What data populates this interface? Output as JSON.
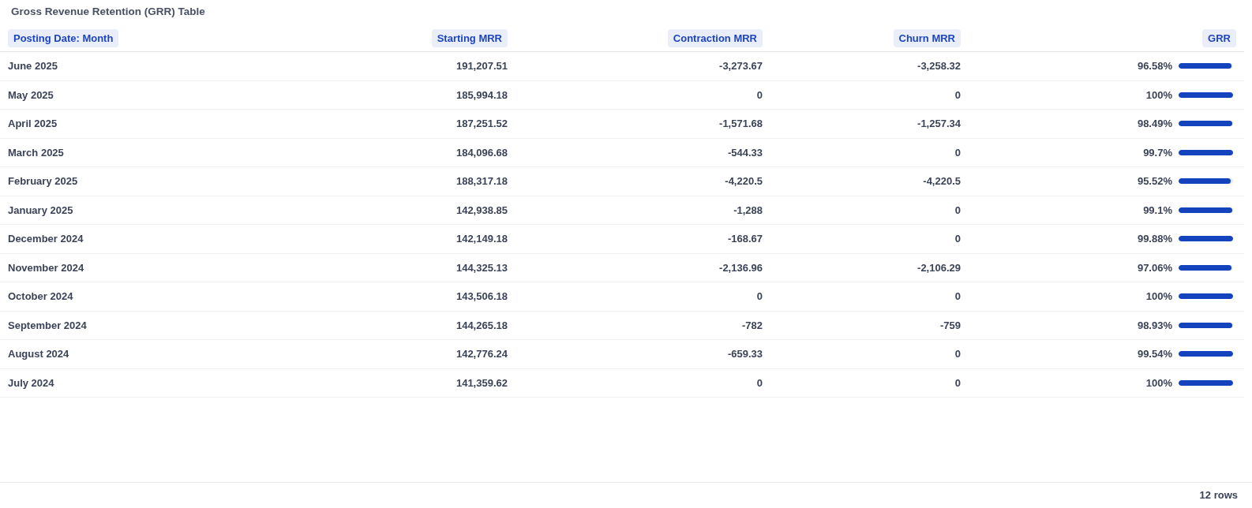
{
  "title": "Gross Revenue Retention (GRR) Table",
  "table": {
    "columns": [
      "Posting Date: Month",
      "Starting MRR",
      "Contraction MRR",
      "Churn MRR",
      "GRR"
    ],
    "rows": [
      {
        "month": "June 2025",
        "starting_mrr": "191,207.51",
        "contraction_mrr": "-3,273.67",
        "churn_mrr": "-3,258.32",
        "grr": "96.58%",
        "level": 0.9658
      },
      {
        "month": "May 2025",
        "starting_mrr": "185,994.18",
        "contraction_mrr": "0",
        "churn_mrr": "0",
        "grr": "100%",
        "level": 1
      },
      {
        "month": "April 2025",
        "starting_mrr": "187,251.52",
        "contraction_mrr": "-1,571.68",
        "churn_mrr": "-1,257.34",
        "grr": "98.49%",
        "level": 0.9849
      },
      {
        "month": "March 2025",
        "starting_mrr": "184,096.68",
        "contraction_mrr": "-544.33",
        "churn_mrr": "0",
        "grr": "99.7%",
        "level": 0.997
      },
      {
        "month": "February 2025",
        "starting_mrr": "188,317.18",
        "contraction_mrr": "-4,220.5",
        "churn_mrr": "-4,220.5",
        "grr": "95.52%",
        "level": 0.9552
      },
      {
        "month": "January 2025",
        "starting_mrr": "142,938.85",
        "contraction_mrr": "-1,288",
        "churn_mrr": "0",
        "grr": "99.1%",
        "level": 0.991
      },
      {
        "month": "December 2024",
        "starting_mrr": "142,149.18",
        "contraction_mrr": "-168.67",
        "churn_mrr": "0",
        "grr": "99.88%",
        "level": 0.9988
      },
      {
        "month": "November 2024",
        "starting_mrr": "144,325.13",
        "contraction_mrr": "-2,136.96",
        "churn_mrr": "-2,106.29",
        "grr": "97.06%",
        "level": 0.9706
      },
      {
        "month": "October 2024",
        "starting_mrr": "143,506.18",
        "contraction_mrr": "0",
        "churn_mrr": "0",
        "grr": "100%",
        "level": 1
      },
      {
        "month": "September 2024",
        "starting_mrr": "144,265.18",
        "contraction_mrr": "-782",
        "churn_mrr": "-759",
        "grr": "98.93%",
        "level": 0.9893
      },
      {
        "month": "August 2024",
        "starting_mrr": "142,776.24",
        "contraction_mrr": "-659.33",
        "churn_mrr": "0",
        "grr": "99.54%",
        "level": 0.9954
      },
      {
        "month": "July 2024",
        "starting_mrr": "141,359.62",
        "contraction_mrr": "0",
        "churn_mrr": "0",
        "grr": "100%",
        "level": 1
      }
    ]
  },
  "footer": {
    "row_count": "12 rows"
  }
}
